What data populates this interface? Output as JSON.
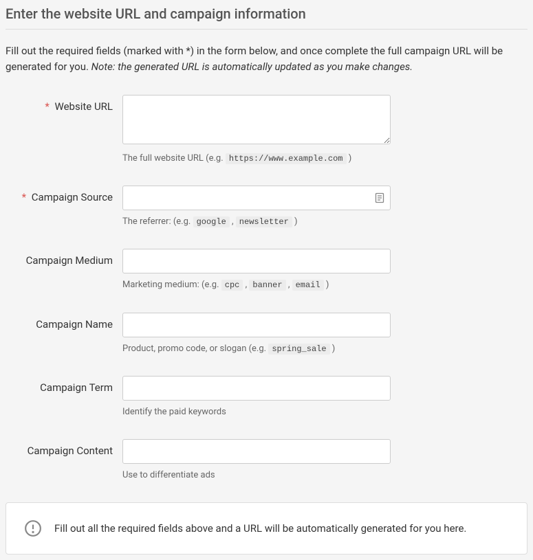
{
  "page": {
    "title": "Enter the website URL and campaign information",
    "intro_prefix": "Fill out the required fields (marked with *) in the form below, and once complete the full campaign URL will be generated for you. ",
    "intro_note": "Note: the generated URL is automatically updated as you make changes."
  },
  "fields": {
    "website_url": {
      "label": "Website URL",
      "required": true,
      "value": "",
      "help_prefix": "The full website URL (e.g. ",
      "help_code1": "https://www.example.com",
      "help_suffix": " )"
    },
    "campaign_source": {
      "label": "Campaign Source",
      "required": true,
      "value": "",
      "help_prefix": "The referrer: (e.g. ",
      "help_code1": "google",
      "help_sep1": " , ",
      "help_code2": "newsletter",
      "help_suffix": " )"
    },
    "campaign_medium": {
      "label": "Campaign Medium",
      "required": false,
      "value": "",
      "help_prefix": "Marketing medium: (e.g. ",
      "help_code1": "cpc",
      "help_sep1": " , ",
      "help_code2": "banner",
      "help_sep2": " , ",
      "help_code3": "email",
      "help_suffix": " )"
    },
    "campaign_name": {
      "label": "Campaign Name",
      "required": false,
      "value": "",
      "help_prefix": "Product, promo code, or slogan (e.g. ",
      "help_code1": "spring_sale",
      "help_suffix": " )"
    },
    "campaign_term": {
      "label": "Campaign Term",
      "required": false,
      "value": "",
      "help": "Identify the paid keywords"
    },
    "campaign_content": {
      "label": "Campaign Content",
      "required": false,
      "value": "",
      "help": "Use to differentiate ads"
    }
  },
  "result": {
    "message": "Fill out all the required fields above and a URL will be automatically generated for you here."
  }
}
